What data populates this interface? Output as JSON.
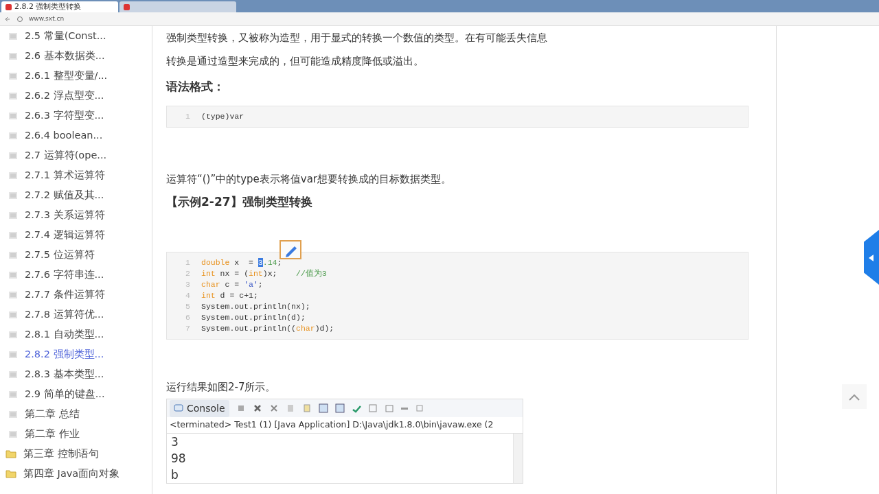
{
  "browser": {
    "tabs": [
      {
        "title": "2.8.2 强制类型转换",
        "selected": true
      },
      {
        "selected": false
      }
    ],
    "address": "www.sxt.cn"
  },
  "sidebar": {
    "items": [
      {
        "label": "2.5 常量(Const...",
        "kind": "page",
        "selected": false
      },
      {
        "label": "2.6 基本数据类...",
        "kind": "page",
        "selected": false
      },
      {
        "label": "2.6.1 整型变量/...",
        "kind": "page",
        "selected": false
      },
      {
        "label": "2.6.2 浮点型变...",
        "kind": "page",
        "selected": false
      },
      {
        "label": "2.6.3 字符型变...",
        "kind": "page",
        "selected": false
      },
      {
        "label": "2.6.4 boolean...",
        "kind": "page",
        "selected": false
      },
      {
        "label": "2.7 运算符(ope...",
        "kind": "page",
        "selected": false
      },
      {
        "label": "2.7.1 算术运算符",
        "kind": "page",
        "selected": false
      },
      {
        "label": "2.7.2 赋值及其...",
        "kind": "page",
        "selected": false
      },
      {
        "label": "2.7.3 关系运算符",
        "kind": "page",
        "selected": false
      },
      {
        "label": "2.7.4 逻辑运算符",
        "kind": "page",
        "selected": false
      },
      {
        "label": "2.7.5 位运算符",
        "kind": "page",
        "selected": false
      },
      {
        "label": "2.7.6 字符串连...",
        "kind": "page",
        "selected": false
      },
      {
        "label": "2.7.7 条件运算符",
        "kind": "page",
        "selected": false
      },
      {
        "label": "2.7.8 运算符优...",
        "kind": "page",
        "selected": false
      },
      {
        "label": "2.8.1 自动类型...",
        "kind": "page",
        "selected": false
      },
      {
        "label": "2.8.2 强制类型...",
        "kind": "page",
        "selected": true
      },
      {
        "label": "2.8.3 基本类型...",
        "kind": "page",
        "selected": false
      },
      {
        "label": "2.9 简单的键盘...",
        "kind": "page",
        "selected": false
      },
      {
        "label": "第二章 总结",
        "kind": "page",
        "selected": false
      },
      {
        "label": "第二章 作业",
        "kind": "page",
        "selected": false
      },
      {
        "label": "第三章 控制语句",
        "kind": "folder",
        "selected": false
      },
      {
        "label": "第四章 Java面向对象",
        "kind": "folder",
        "selected": false
      }
    ]
  },
  "content": {
    "intro": [
      "强制类型转换，又被称为造型，用于显式的转换一个数值的类型。在有可能丢失信息",
      "转换是通过造型来完成的，但可能造成精度降低或溢出。"
    ],
    "syntax_heading": "语法格式：",
    "syntax_code": [
      {
        "number": "1",
        "tokens": [
          {
            "text": "(type)var",
            "kind": "plain"
          }
        ]
      }
    ],
    "explain": "运算符“()”中的type表示将值var想要转换成的目标数据类型。",
    "example_heading": "【示例2-27】强制类型转换",
    "example_code": [
      {
        "number": "1",
        "tokens": [
          {
            "text": "double",
            "kind": "keyword"
          },
          {
            "text": " x  = ",
            "kind": "plain"
          },
          {
            "text": "3",
            "kind": "selected"
          },
          {
            "text": ".14",
            "kind": "number"
          },
          {
            "text": ";",
            "kind": "plain"
          }
        ]
      },
      {
        "number": "2",
        "tokens": [
          {
            "text": "int",
            "kind": "keyword"
          },
          {
            "text": " nx = (",
            "kind": "plain"
          },
          {
            "text": "int",
            "kind": "keyword"
          },
          {
            "text": ")x;    ",
            "kind": "plain"
          },
          {
            "text": "//值为3",
            "kind": "comment"
          }
        ]
      },
      {
        "number": "3",
        "tokens": [
          {
            "text": "char",
            "kind": "keyword"
          },
          {
            "text": " c = ",
            "kind": "plain"
          },
          {
            "text": "'a'",
            "kind": "string"
          },
          {
            "text": ";",
            "kind": "plain"
          }
        ]
      },
      {
        "number": "4",
        "tokens": [
          {
            "text": "int",
            "kind": "keyword"
          },
          {
            "text": " d = c+1;",
            "kind": "plain"
          }
        ]
      },
      {
        "number": "5",
        "tokens": [
          {
            "text": "System.out.println(nx);",
            "kind": "plain"
          }
        ]
      },
      {
        "number": "6",
        "tokens": [
          {
            "text": "System.out.println(d);",
            "kind": "plain"
          }
        ]
      },
      {
        "number": "7",
        "tokens": [
          {
            "text": "System.out.println((",
            "kind": "plain"
          },
          {
            "text": "char",
            "kind": "keyword"
          },
          {
            "text": ")d);",
            "kind": "plain"
          }
        ]
      }
    ],
    "result_text": "运行结果如图2-7所示。",
    "console": {
      "tab": "Console",
      "header": "<terminated> Test1 (1) [Java Application] D:\\Java\\jdk1.8.0\\bin\\javaw.exe (2",
      "output": [
        "3",
        "98",
        "b"
      ]
    }
  }
}
